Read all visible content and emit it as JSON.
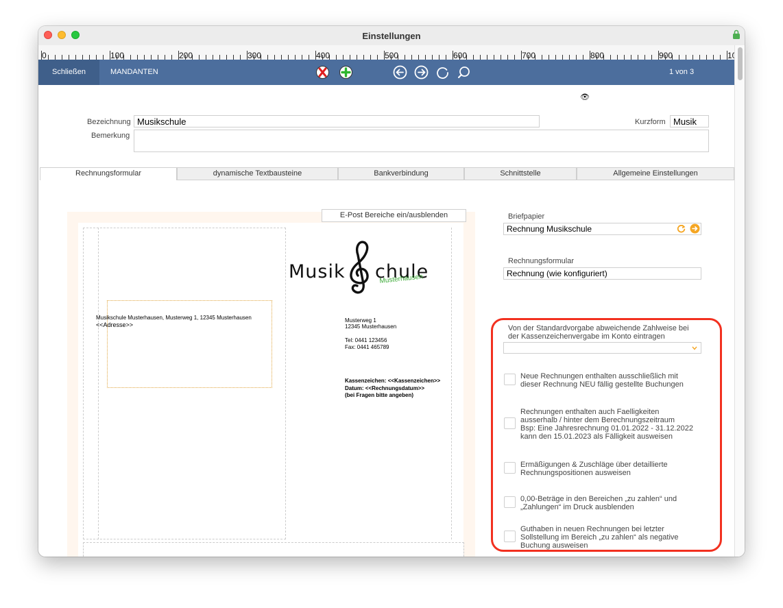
{
  "window": {
    "title": "Einstellungen"
  },
  "ruler": {
    "labels": [
      "0",
      "100",
      "200",
      "300",
      "400",
      "500",
      "600",
      "700",
      "800",
      "900",
      "10"
    ]
  },
  "toolbar": {
    "close_label": "Schließen",
    "section_label": "MANDANTEN",
    "record_counter": "1 von 3"
  },
  "header": {
    "bezeichnung_label": "Bezeichnung",
    "bezeichnung_value": "Musikschule",
    "kurzform_label": "Kurzform",
    "kurzform_value": "Musik",
    "bemerkung_label": "Bemerkung",
    "bemerkung_value": ""
  },
  "tabs": [
    "Rechnungsformular",
    "dynamische Textbausteine",
    "Bankverbindung",
    "Schnittstelle",
    "Allgemeine Einstellungen"
  ],
  "preview": {
    "epost_button": "E-Post Bereiche ein/ausblenden",
    "logo_main": "Musik",
    "logo_schule": "chule",
    "logo_sub": "Musterhausen",
    "sender_line": "Musikschule Musterhausen, Musterweg 1, 12345 Musterhausen",
    "address_placeholder": "<<Adresse>>",
    "street": "Musterweg 1",
    "city": "12345 Musterhausen",
    "tel": "Tel:  0441 123456",
    "fax": "Fax: 0441 465789",
    "kassenzeichen": "Kassenzeichen: <<Kassenzeichen>>",
    "datum": "Datum: <<Rechnungsdatum>>",
    "hint": "(bei Fragen bitte angeben)"
  },
  "right": {
    "briefpapier_label": "Briefpapier",
    "briefpapier_value": "Rechnung Musikschule",
    "rechnungsformular_label": "Rechnungsformular",
    "rechnungsformular_value": "Rechnung (wie konfiguriert)",
    "zahlweise_label_1": "Von der Standardvorgabe abweichende Zahlweise bei",
    "zahlweise_label_2": "der Kassenzeichenvergabe im Konto eintragen",
    "options": [
      {
        "lines": [
          "Neue Rechnungen enthalten ausschließlich mit",
          "dieser Rechnung NEU fällig gestellte Buchungen"
        ]
      },
      {
        "lines": [
          "Rechnungen enthalten auch Faelligkeiten",
          "ausserhalb / hinter dem Berechnungszeitraum",
          "Bsp: Eine Jahresrechnung 01.01.2022 - 31.12.2022",
          "kann den 15.01.2023 als Fälligkeit ausweisen"
        ]
      },
      {
        "lines": [
          "Ermäßigungen & Zuschläge über detaillierte",
          "Rechnungspositionen ausweisen"
        ]
      },
      {
        "lines": [
          "0,00-Beträge in den Bereichen „zu zahlen“ und",
          "„Zahlungen“ im Druck ausblenden"
        ]
      },
      {
        "lines": [
          "Guthaben in neuen Rechnungen bei letzter",
          "Sollstellung im Bereich „zu zahlen“ als negative",
          "Buchung ausweisen"
        ]
      }
    ]
  },
  "colors": {
    "toolbar": "#4c6e9d",
    "highlight": "#f2301f",
    "accent_orange": "#f5a623",
    "logo_green": "#3aa935"
  }
}
